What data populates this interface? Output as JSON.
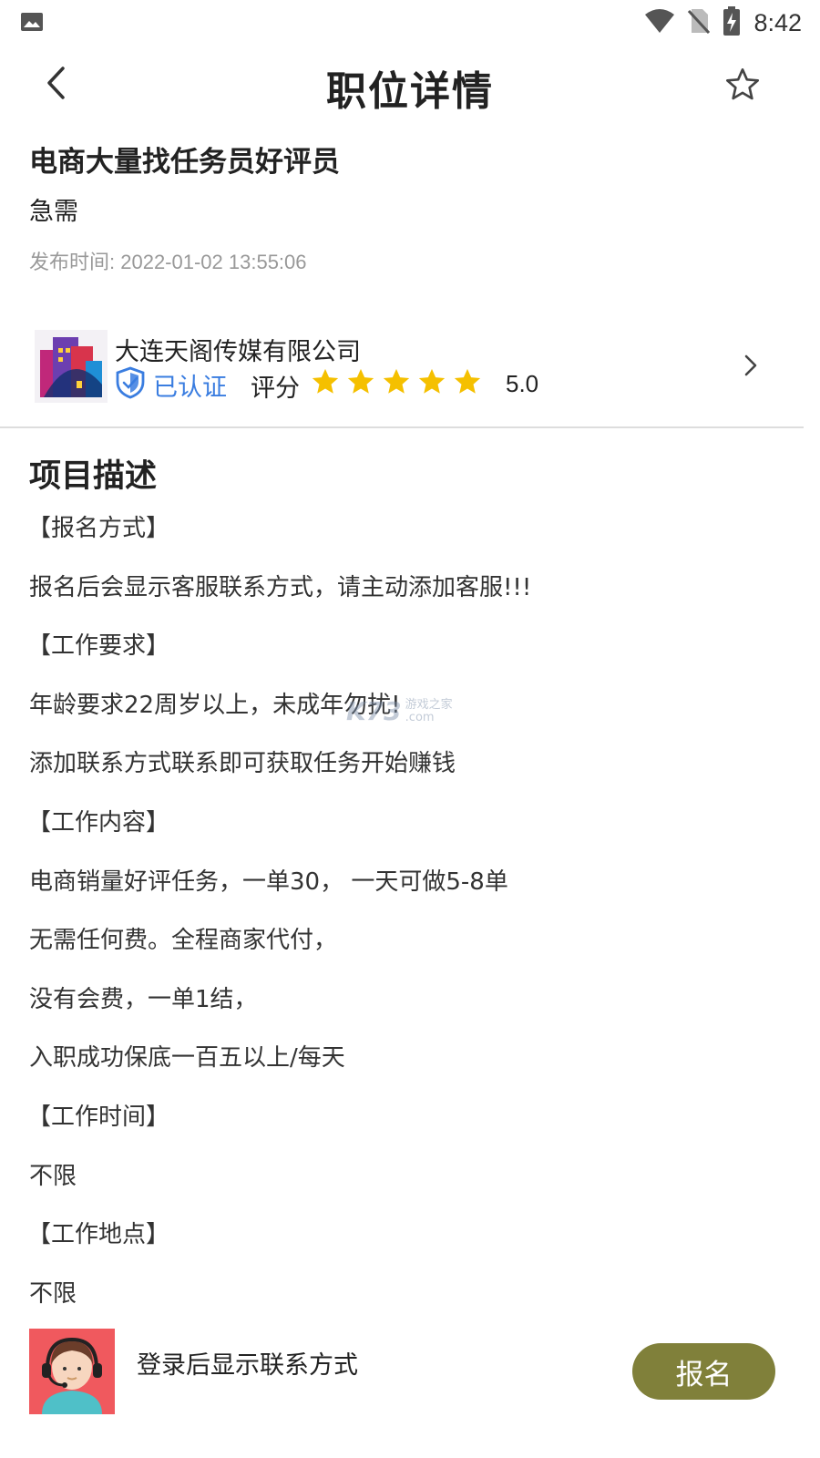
{
  "status_bar": {
    "time": "8:42",
    "icons": [
      "gallery-icon",
      "wifi-icon",
      "no-sim-icon",
      "battery-charging-icon"
    ]
  },
  "header": {
    "title": "职位详情",
    "back_icon": "chevron-left-icon",
    "favorite_icon": "star-outline-icon"
  },
  "job": {
    "title": "电商大量找任务员好评员",
    "tag": "急需",
    "publish_label": "发布时间: ",
    "publish_time": "2022-01-02 13:55:06"
  },
  "company": {
    "name": "大连天阁传媒有限公司",
    "verified_label": "已认证",
    "rating_label": "评分",
    "rating_value": "5.0",
    "stars": 5,
    "star_color": "#f5c000",
    "verified_color": "#3a7de0"
  },
  "description": {
    "title": "项目描述",
    "lines": [
      "【报名方式】",
      "报名后会显示客服联系方式，请主动添加客服!!!",
      "【工作要求】",
      "年龄要求22周岁以上，未成年勿扰!",
      "添加联系方式联系即可获取任务开始赚钱",
      "【工作内容】",
      "电商销量好评任务，一单30， 一天可做5-8单",
      "无需任何费。全程商家代付，",
      "没有会费，一单1结，",
      "入职成功保底一百五以上/每天",
      "【工作时间】",
      "不限",
      "【工作地点】",
      "不限"
    ]
  },
  "watermark": {
    "logo": "K73",
    "text1": "游戏之家",
    "text2": ".com"
  },
  "bottom": {
    "contact_hint": "登录后显示联系方式",
    "apply_label": "报名",
    "apply_color": "#80803a"
  }
}
